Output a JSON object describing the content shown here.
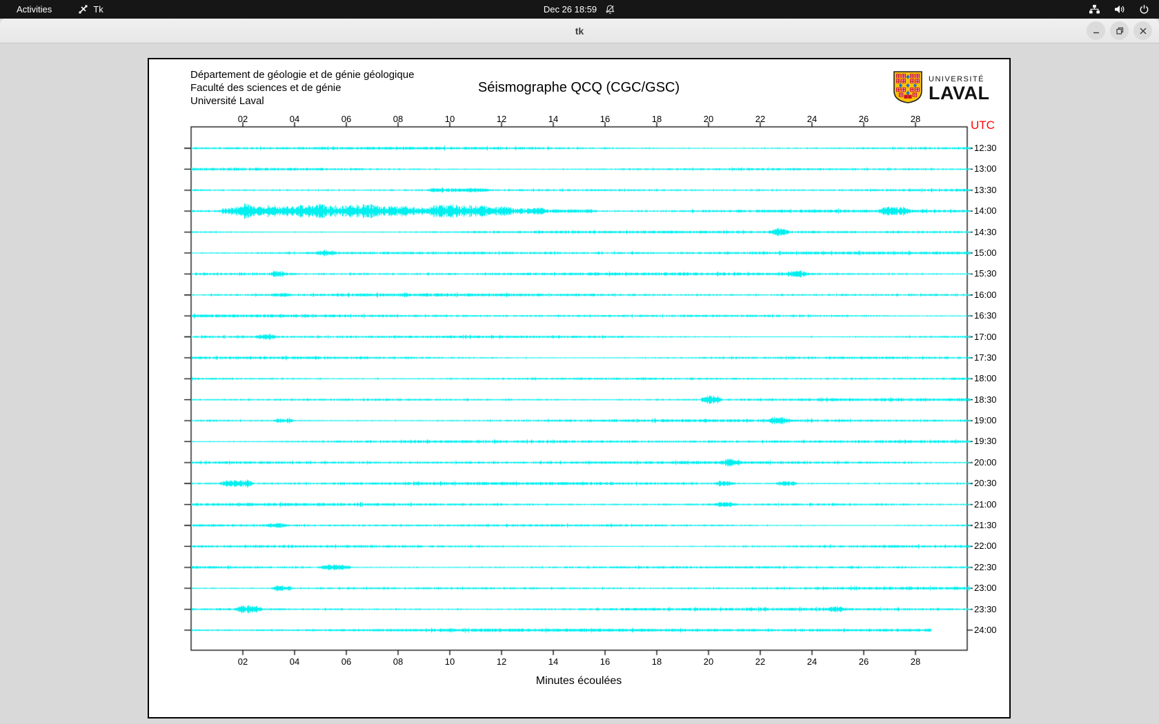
{
  "top_bar": {
    "activities": "Activities",
    "app_name": "Tk",
    "clock": "Dec 26 18:59",
    "notifications_muted": true,
    "system_icons": [
      "network",
      "volume",
      "power"
    ]
  },
  "window": {
    "title": "tk",
    "controls": [
      "minimize",
      "maximize",
      "close"
    ]
  },
  "seismograph": {
    "institution_lines": [
      "Département de géologie et de génie géologique",
      "Faculté des sciences et de génie",
      "Université Laval"
    ],
    "title": "Séismographe QCQ (CGC/GSC)",
    "logo": {
      "text_top": "UNIVERSITÉ",
      "text_bottom": "LAVAL",
      "shield_red": "#cc1126",
      "shield_yellow": "#f6c20a",
      "shield_blue": "#1f6fd0"
    },
    "utc_label": "UTC",
    "utc_color": "#ff0000",
    "x_axis_label": "Minutes écoulées",
    "trace_color": "#00efef"
  },
  "chart_data": {
    "type": "line",
    "subtype": "helicorder",
    "title": "Séismographe QCQ (CGC/GSC)",
    "xlabel": "Minutes écoulées",
    "x_range_minutes": [
      0,
      30
    ],
    "x_ticks": [
      "02",
      "04",
      "06",
      "08",
      "10",
      "12",
      "14",
      "16",
      "18",
      "20",
      "22",
      "24",
      "26",
      "28"
    ],
    "note": "24 half-hour seismic traces (cyan) stacked top to bottom, UTC start time labelled at right; strongest burst on the 14:00 trace between ~1.5 and ~13 minutes.",
    "rows": [
      {
        "utc": "12:30",
        "end_min": 30,
        "events": []
      },
      {
        "utc": "13:00",
        "end_min": 30,
        "events": []
      },
      {
        "utc": "13:30",
        "end_min": 30,
        "events": [
          {
            "t0": 9.3,
            "t1": 11.3,
            "a": 1.8
          }
        ]
      },
      {
        "utc": "14:00",
        "end_min": 30,
        "events": [
          {
            "t0": 1.3,
            "t1": 2.1,
            "a": 5
          },
          {
            "t0": 2.1,
            "t1": 3.0,
            "a": 8
          },
          {
            "t0": 3.2,
            "t1": 3.9,
            "a": 6
          },
          {
            "t0": 4.2,
            "t1": 5.0,
            "a": 9
          },
          {
            "t0": 5.1,
            "t1": 6.0,
            "a": 7
          },
          {
            "t0": 6.2,
            "t1": 7.0,
            "a": 9
          },
          {
            "t0": 7.2,
            "t1": 8.2,
            "a": 7
          },
          {
            "t0": 8.3,
            "t1": 9.0,
            "a": 5
          },
          {
            "t0": 9.3,
            "t1": 10.1,
            "a": 9
          },
          {
            "t0": 10.3,
            "t1": 11.2,
            "a": 8
          },
          {
            "t0": 11.3,
            "t1": 12.2,
            "a": 6
          },
          {
            "t0": 12.3,
            "t1": 13.5,
            "a": 4
          },
          {
            "t0": 13.5,
            "t1": 15.5,
            "a": 2
          },
          {
            "t0": 26.8,
            "t1": 27.6,
            "a": 4.5
          }
        ]
      },
      {
        "utc": "14:30",
        "end_min": 30,
        "events": [
          {
            "t0": 22.5,
            "t1": 22.9,
            "a": 4.5
          }
        ]
      },
      {
        "utc": "15:00",
        "end_min": 30,
        "events": [
          {
            "t0": 5.0,
            "t1": 5.4,
            "a": 2.6
          }
        ]
      },
      {
        "utc": "15:30",
        "end_min": 30,
        "events": [
          {
            "t0": 3.2,
            "t1": 3.5,
            "a": 3.5
          },
          {
            "t0": 23.2,
            "t1": 23.6,
            "a": 3.8
          }
        ]
      },
      {
        "utc": "16:00",
        "end_min": 30,
        "events": [
          {
            "t0": 3.3,
            "t1": 3.6,
            "a": 1.6
          }
        ]
      },
      {
        "utc": "16:30",
        "end_min": 30,
        "events": []
      },
      {
        "utc": "17:00",
        "end_min": 30,
        "events": [
          {
            "t0": 2.7,
            "t1": 3.1,
            "a": 3.2
          }
        ]
      },
      {
        "utc": "17:30",
        "end_min": 30,
        "events": []
      },
      {
        "utc": "18:00",
        "end_min": 30,
        "events": []
      },
      {
        "utc": "18:30",
        "end_min": 30,
        "events": [
          {
            "t0": 19.9,
            "t1": 20.3,
            "a": 5.5
          }
        ]
      },
      {
        "utc": "19:00",
        "end_min": 30,
        "events": [
          {
            "t0": 3.4,
            "t1": 3.8,
            "a": 2.6
          },
          {
            "t0": 22.5,
            "t1": 22.9,
            "a": 3.8
          }
        ]
      },
      {
        "utc": "19:30",
        "end_min": 30,
        "events": []
      },
      {
        "utc": "20:00",
        "end_min": 30,
        "events": [
          {
            "t0": 20.7,
            "t1": 21.1,
            "a": 3.8
          }
        ]
      },
      {
        "utc": "20:30",
        "end_min": 30,
        "events": [
          {
            "t0": 1.3,
            "t1": 2.2,
            "a": 4.2
          },
          {
            "t0": 20.4,
            "t1": 20.8,
            "a": 3.5
          },
          {
            "t0": 22.8,
            "t1": 23.2,
            "a": 3.2
          }
        ]
      },
      {
        "utc": "21:00",
        "end_min": 30,
        "events": [
          {
            "t0": 20.4,
            "t1": 20.8,
            "a": 2.6
          }
        ]
      },
      {
        "utc": "21:30",
        "end_min": 30,
        "events": [
          {
            "t0": 3.1,
            "t1": 3.5,
            "a": 2.6
          }
        ]
      },
      {
        "utc": "22:00",
        "end_min": 30,
        "events": []
      },
      {
        "utc": "22:30",
        "end_min": 30,
        "events": [
          {
            "t0": 5.2,
            "t1": 6.0,
            "a": 3.5
          }
        ]
      },
      {
        "utc": "23:00",
        "end_min": 30,
        "events": [
          {
            "t0": 3.3,
            "t1": 3.7,
            "a": 3.5
          }
        ]
      },
      {
        "utc": "23:30",
        "end_min": 30,
        "events": [
          {
            "t0": 1.9,
            "t1": 2.5,
            "a": 5
          },
          {
            "t0": 24.7,
            "t1": 25.1,
            "a": 2.6
          }
        ]
      },
      {
        "utc": "24:00",
        "end_min": 28.6,
        "events": [
          {
            "t0": 0,
            "t1": 28.6,
            "a": 0.5
          }
        ]
      }
    ]
  }
}
